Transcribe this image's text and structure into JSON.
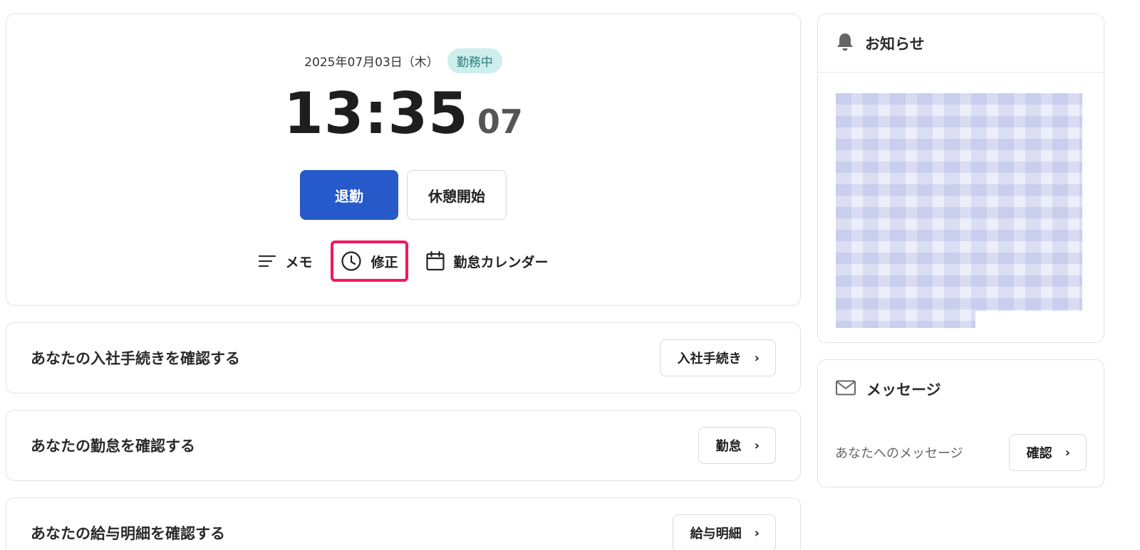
{
  "clock": {
    "date": "2025年07月03日（木）",
    "status": "勤務中",
    "time": "13:35",
    "seconds": "07",
    "primary_button": "退勤",
    "secondary_button": "休憩開始",
    "actions": [
      {
        "label": "メモ",
        "icon": "memo-lines-icon"
      },
      {
        "label": "修正",
        "icon": "clock-icon",
        "highlighted": true
      },
      {
        "label": "勤怠カレンダー",
        "icon": "calendar-icon"
      }
    ]
  },
  "links": [
    {
      "title": "あなたの入社手続きを確認する",
      "button": "入社手続き"
    },
    {
      "title": "あなたの勤怠を確認する",
      "button": "勤怠"
    },
    {
      "title": "あなたの給与明細を確認する",
      "button": "給与明細"
    }
  ],
  "notice": {
    "title": "お知らせ",
    "icon": "bell-icon"
  },
  "message": {
    "title": "メッセージ",
    "icon": "envelope-icon",
    "text": "あなたへのメッセージ",
    "button": "確認"
  },
  "colors": {
    "primary": "#2659c9",
    "badge_bg": "#cdeeed",
    "badge_text": "#2b7d7a",
    "highlight": "#f0185f"
  }
}
